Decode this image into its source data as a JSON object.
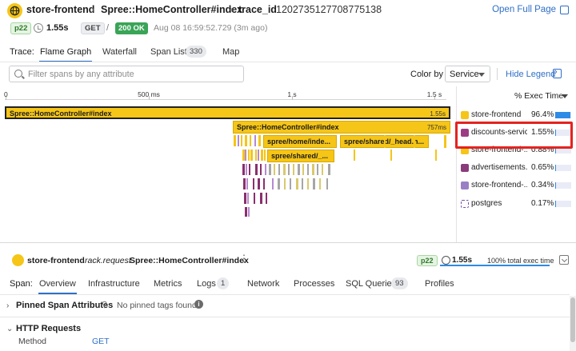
{
  "header": {
    "service": "store-frontend",
    "resource": "Spree::HomeController#index",
    "trace_id_label": "trace_id",
    "trace_id": "1202735127708775138",
    "open_full_page": "Open Full Page",
    "env": "p22",
    "duration": "1.55s",
    "method": "GET",
    "slash": "/",
    "status": "200 OK",
    "timestamp": "Aug 08 16:59:52.729 (3m ago)"
  },
  "trace_tabs": {
    "label": "Trace:",
    "items": [
      {
        "label": "Flame Graph"
      },
      {
        "label": "Waterfall"
      },
      {
        "label": "Span List",
        "badge": "330"
      },
      {
        "label": "Map"
      }
    ]
  },
  "filter": {
    "search_placeholder": "Filter spans by any attribute",
    "color_by_label": "Color by",
    "color_by_value": "Service",
    "hide_legend": "Hide Legend"
  },
  "flame": {
    "ticks": [
      "0",
      "500 ms",
      "1 s",
      "1.5 s"
    ],
    "spans": [
      {
        "name": "Spree::HomeController#index",
        "duration": "1.55s"
      },
      {
        "name": "Spree::HomeController#index",
        "duration": "757ms"
      },
      {
        "name": "spree/home/inde..."
      },
      {
        "name": "spree/shared/_head.h..."
      },
      {
        "name": "spree/shared/_..."
      }
    ]
  },
  "legend": {
    "header": "% Exec Time",
    "items": [
      {
        "name": "store-frontend",
        "pct": "96.4%",
        "color": "#f5c518",
        "fill": 0.964
      },
      {
        "name": "discounts-service",
        "pct": "1.55%",
        "color": "#9c3d83",
        "fill": 0.0155
      },
      {
        "name": "store-frontend-...",
        "pct": "0.88%",
        "color": "#f5c518",
        "fill": 0.0088
      },
      {
        "name": "advertisements...",
        "pct": "0.65%",
        "color": "#8a3b7a",
        "fill": 0.0065
      },
      {
        "name": "store-frontend-...",
        "pct": "0.34%",
        "color": "#9a7fc4",
        "fill": 0.0034
      },
      {
        "name": "postgres",
        "pct": "0.17%",
        "color": "#7b4fa8",
        "fill": 0.0017
      }
    ]
  },
  "span_panel": {
    "service": "store-frontend",
    "operation": "rack.request",
    "resource": "Spree::HomeController#index",
    "env": "p22",
    "duration": "1.55s",
    "total_exec": "100% total exec time",
    "tabs_label": "Span:",
    "tabs": [
      {
        "label": "Overview"
      },
      {
        "label": "Infrastructure"
      },
      {
        "label": "Metrics"
      },
      {
        "label": "Logs",
        "badge": "1"
      },
      {
        "label": "Network"
      },
      {
        "label": "Processes"
      },
      {
        "label": "SQL Queries",
        "badge": "93"
      },
      {
        "label": "Profiles"
      }
    ],
    "pinned_title": "Pinned Span Attributes",
    "no_pinned": "No pinned tags found",
    "http_title": "HTTP Requests",
    "http_method_key": "Method",
    "http_method_value": "GET"
  }
}
